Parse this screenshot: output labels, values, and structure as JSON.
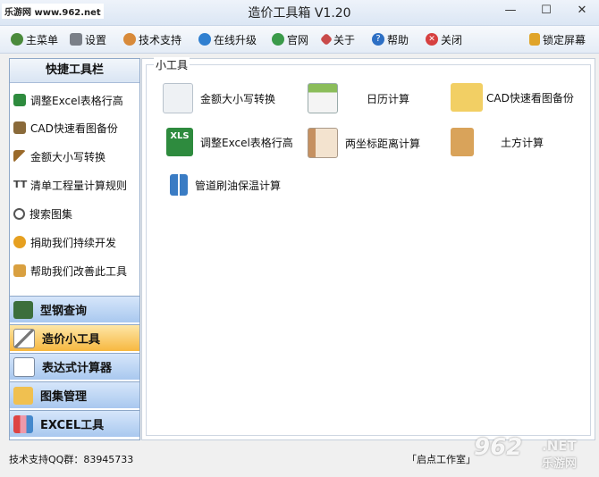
{
  "watermark_top": "乐游网 www.962.net",
  "window": {
    "title": "造价工具箱 V1.20",
    "min": "—",
    "max": "☐",
    "close": "✕"
  },
  "toolbar": {
    "main_menu": "主菜单",
    "settings": "设置",
    "tech_support": "技术支持",
    "online_upgrade": "在线升级",
    "official_site": "官网",
    "about": "关于",
    "help": "帮助",
    "close": "关闭",
    "lock_screen": "锁定屏幕"
  },
  "sidebar": {
    "header": "快捷工具栏",
    "items": [
      {
        "label": "调整Excel表格行高",
        "icon": "excel-icon"
      },
      {
        "label": "CAD快速看图备份",
        "icon": "cad-icon"
      },
      {
        "label": "金额大小写转换",
        "icon": "ruler-icon"
      },
      {
        "label": "清单工程量计算规则",
        "icon": "tt-icon"
      },
      {
        "label": "搜索图集",
        "icon": "magnifier-icon"
      },
      {
        "label": "捐助我们持续开发",
        "icon": "medal-icon"
      },
      {
        "label": "帮助我们改善此工具",
        "icon": "edit-icon"
      }
    ],
    "sections": [
      {
        "label": "型钢查询",
        "active": false
      },
      {
        "label": "造价小工具",
        "active": true
      },
      {
        "label": "表达式计算器",
        "active": false
      },
      {
        "label": "图集管理",
        "active": false
      },
      {
        "label": "EXCEL工具",
        "active": false
      }
    ]
  },
  "main": {
    "group_title": "小工具",
    "tools": [
      {
        "label": "金额大小写转换"
      },
      {
        "label": "日历计算"
      },
      {
        "label": "CAD快速看图备份"
      },
      {
        "label": "调整Excel表格行高",
        "badge": "XLS"
      },
      {
        "label": "两坐标距离计算"
      },
      {
        "label": "土方计算"
      },
      {
        "label": "管道刷油保温计算"
      }
    ]
  },
  "status": {
    "left": "技术支持QQ群：83945733",
    "right": "「启点工作室」"
  },
  "watermark_logo": {
    "big": "962",
    "net": ".NET",
    "cn": "乐游网"
  }
}
